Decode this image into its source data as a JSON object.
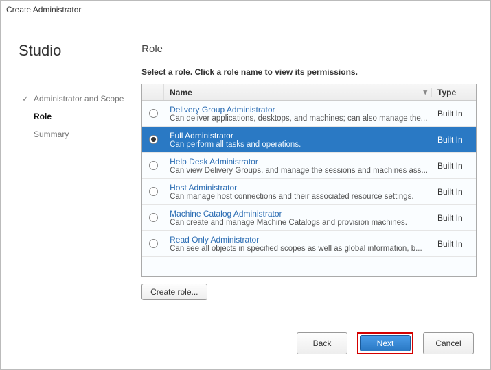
{
  "window": {
    "title": "Create Administrator"
  },
  "sidebar": {
    "brand": "Studio",
    "steps": [
      {
        "label": "Administrator and Scope",
        "done": true,
        "current": false
      },
      {
        "label": "Role",
        "done": false,
        "current": true
      },
      {
        "label": "Summary",
        "done": false,
        "current": false
      }
    ]
  },
  "content": {
    "heading": "Role",
    "instruction": "Select a role. Click a role name to view its permissions.",
    "columns": {
      "name": "Name",
      "type": "Type"
    },
    "roles": [
      {
        "title": "Delivery Group Administrator",
        "desc": "Can deliver applications, desktops, and machines; can also manage the...",
        "type": "Built In",
        "selected": false
      },
      {
        "title": "Full Administrator",
        "desc": "Can perform all tasks and operations.",
        "type": "Built In",
        "selected": true
      },
      {
        "title": "Help Desk Administrator",
        "desc": "Can view Delivery Groups, and manage the sessions and machines ass...",
        "type": "Built In",
        "selected": false
      },
      {
        "title": "Host Administrator",
        "desc": "Can manage host connections and their associated resource settings.",
        "type": "Built In",
        "selected": false
      },
      {
        "title": "Machine Catalog Administrator",
        "desc": "Can create and manage Machine Catalogs and provision machines.",
        "type": "Built In",
        "selected": false
      },
      {
        "title": "Read Only Administrator",
        "desc": "Can see all objects in specified scopes as well as global information, b...",
        "type": "Built In",
        "selected": false
      }
    ],
    "create_role": "Create role..."
  },
  "footer": {
    "back": "Back",
    "next": "Next",
    "cancel": "Cancel"
  }
}
